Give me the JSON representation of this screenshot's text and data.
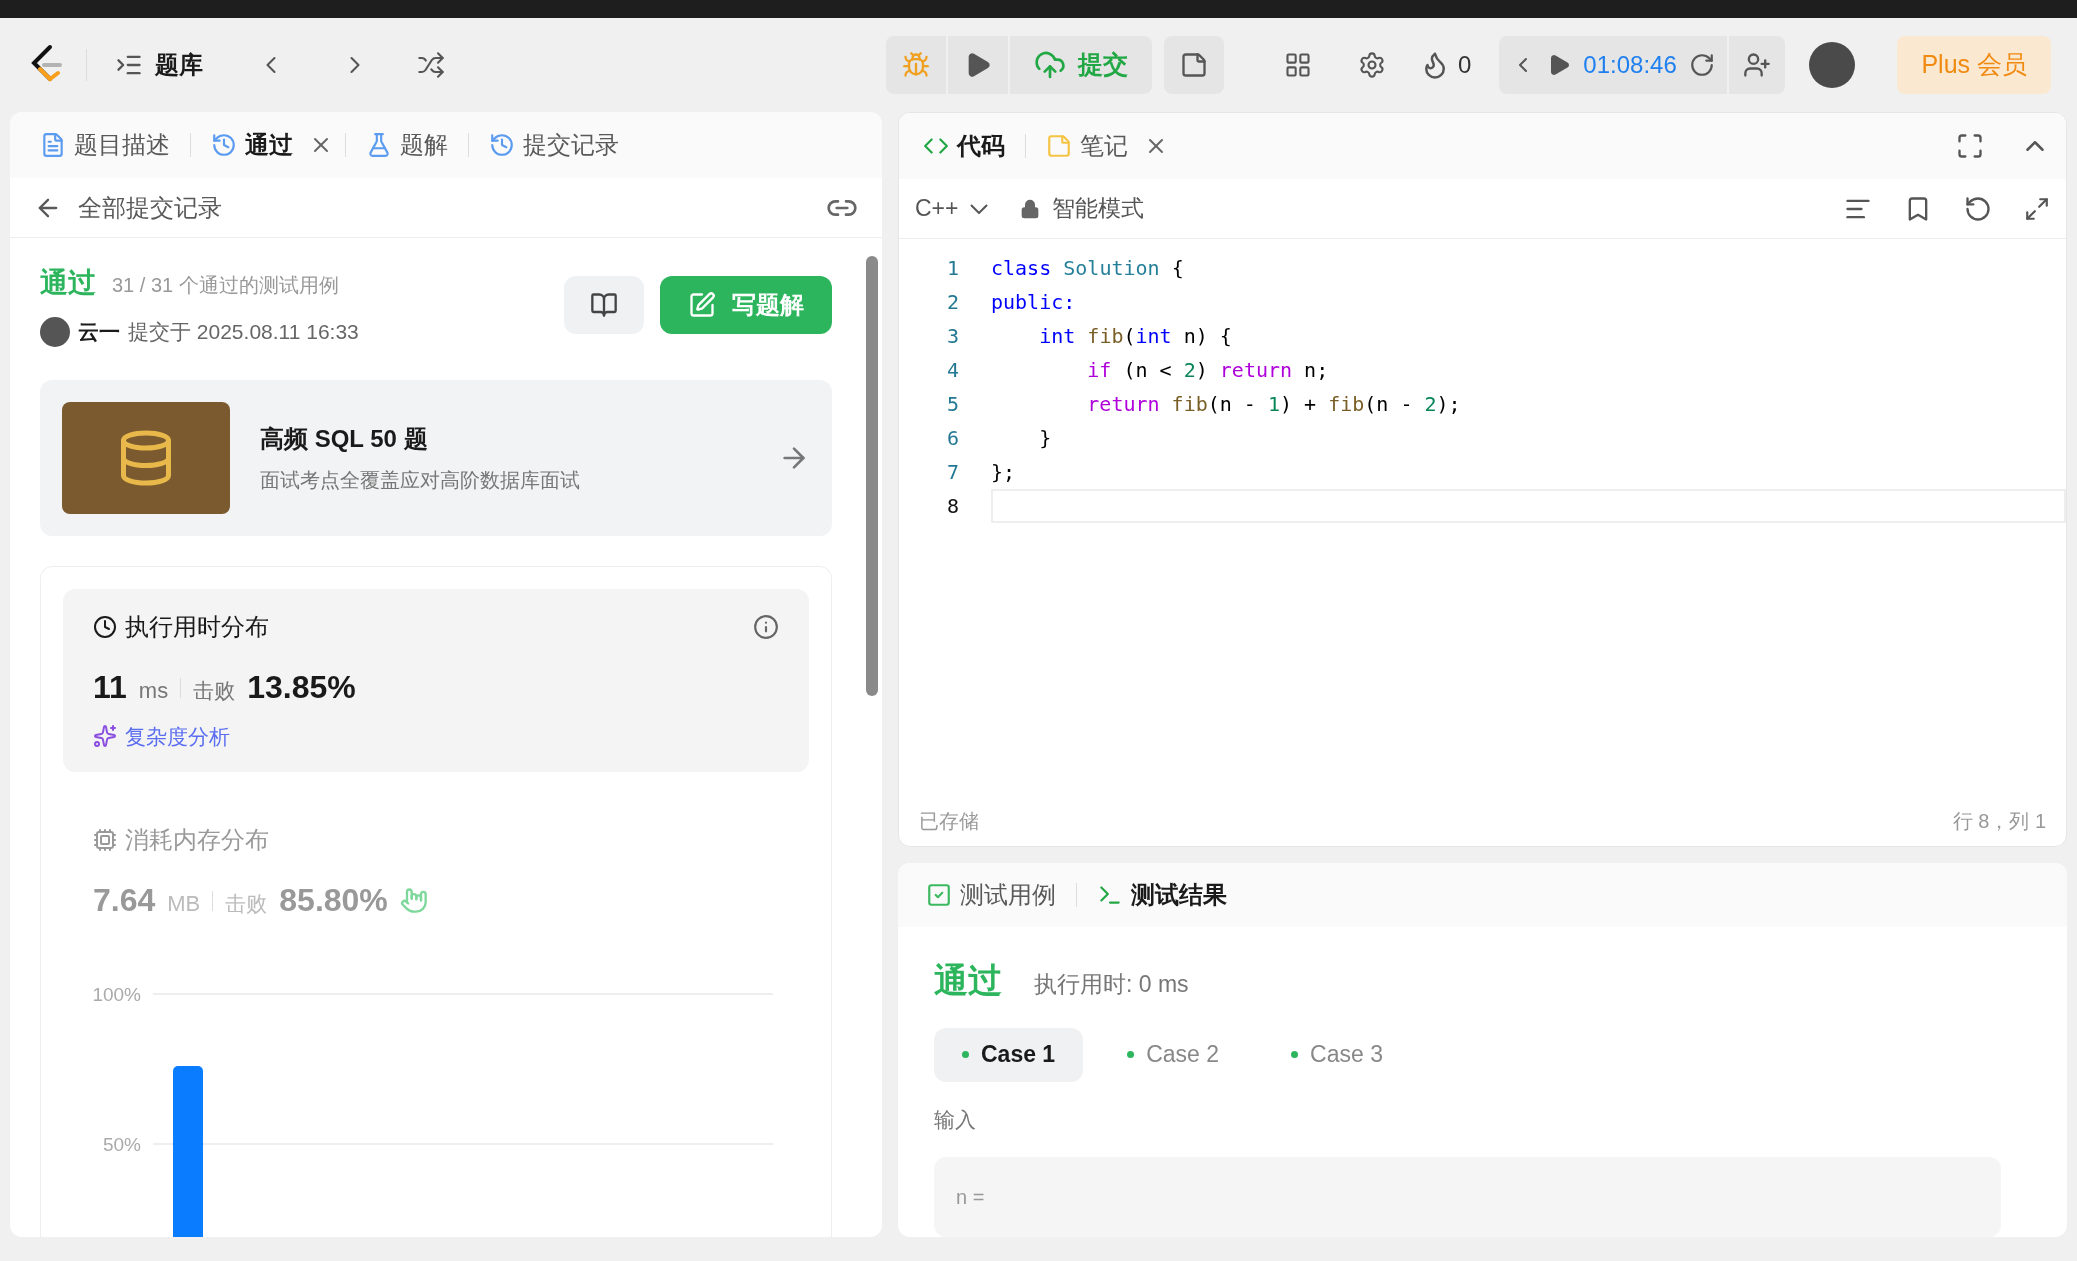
{
  "nav": {
    "problem_list": "题库",
    "submit": "提交",
    "streak": "0",
    "timer": "01:08:46",
    "plus": "Plus 会员"
  },
  "left_tabs": [
    {
      "kind": "doc",
      "label": "题目描述",
      "selected": false,
      "closable": false
    },
    {
      "kind": "history",
      "label": "通过",
      "selected": true,
      "closable": true
    },
    {
      "kind": "flask",
      "label": "题解",
      "selected": false,
      "closable": false
    },
    {
      "kind": "history",
      "label": "提交记录",
      "selected": false,
      "closable": false
    }
  ],
  "back": {
    "label": "全部提交记录"
  },
  "submission": {
    "status": "通过",
    "cases": "31 / 31 个通过的测试用例",
    "user": "云一",
    "submitted": "提交于 2025.08.11 16:33",
    "write_button": "写题解"
  },
  "promo": {
    "title": "高频 SQL 50 题",
    "subtitle": "面试考点全覆盖应对高阶数据库面试"
  },
  "metrics": [
    {
      "kind": "time",
      "title": "执行用时分布",
      "value": "11",
      "unit": "ms",
      "beat_label": "击败",
      "beat": "13.85%",
      "selected": true,
      "analysis": "复杂度分析"
    },
    {
      "kind": "memory",
      "title": "消耗内存分布",
      "value": "7.64",
      "unit": "MB",
      "beat_label": "击败",
      "beat": "85.80%",
      "selected": false
    }
  ],
  "chart_data": {
    "type": "bar",
    "values": [
      76
    ],
    "yticks": [
      {
        "value": 50,
        "label": "50%"
      },
      {
        "value": 100,
        "label": "100%"
      }
    ],
    "ylim": [
      0,
      100
    ]
  },
  "editor_tabs": [
    {
      "kind": "code",
      "label": "代码",
      "selected": true,
      "closable": false
    },
    {
      "kind": "note",
      "label": "笔记",
      "selected": false,
      "closable": true
    }
  ],
  "editor": {
    "language": "C++",
    "mode": "智能模式",
    "saved": "已存储",
    "cursor": "行 8，列 1",
    "lines": [
      {
        "number": "1",
        "current": false,
        "tokens": [
          {
            "text": "class",
            "kind": "keyword"
          },
          {
            "text": " Solution",
            "kind": "type"
          },
          {
            "text": " {",
            "kind": "plain"
          }
        ]
      },
      {
        "number": "2",
        "current": false,
        "tokens": [
          {
            "text": "public:",
            "kind": "keyword"
          }
        ]
      },
      {
        "number": "3",
        "current": false,
        "tokens": [
          {
            "text": "    int",
            "kind": "keyword"
          },
          {
            "text": " fib",
            "kind": "func"
          },
          {
            "text": "(",
            "kind": "plain"
          },
          {
            "text": "int",
            "kind": "keyword"
          },
          {
            "text": " n) {",
            "kind": "plain"
          }
        ]
      },
      {
        "number": "4",
        "current": false,
        "tokens": [
          {
            "text": "        if",
            "kind": "control"
          },
          {
            "text": " (n < ",
            "kind": "plain"
          },
          {
            "text": "2",
            "kind": "number"
          },
          {
            "text": ") ",
            "kind": "plain"
          },
          {
            "text": "return",
            "kind": "control"
          },
          {
            "text": " n;",
            "kind": "plain"
          }
        ]
      },
      {
        "number": "5",
        "current": false,
        "tokens": [
          {
            "text": "        return",
            "kind": "control"
          },
          {
            "text": " fib",
            "kind": "func"
          },
          {
            "text": "(n - ",
            "kind": "plain"
          },
          {
            "text": "1",
            "kind": "number"
          },
          {
            "text": ") + ",
            "kind": "plain"
          },
          {
            "text": "fib",
            "kind": "func"
          },
          {
            "text": "(n - ",
            "kind": "plain"
          },
          {
            "text": "2",
            "kind": "number"
          },
          {
            "text": ");",
            "kind": "plain"
          }
        ]
      },
      {
        "number": "6",
        "current": false,
        "tokens": [
          {
            "text": "    }",
            "kind": "plain"
          }
        ]
      },
      {
        "number": "7",
        "current": false,
        "tokens": [
          {
            "text": "};",
            "kind": "plain"
          }
        ]
      },
      {
        "number": "8",
        "current": true
      }
    ]
  },
  "result_tabs": [
    {
      "kind": "testcase",
      "label": "测试用例",
      "selected": false
    },
    {
      "kind": "terminal",
      "label": "测试结果",
      "selected": true
    }
  ],
  "result": {
    "status": "通过",
    "runtime": "执行用时: 0 ms",
    "input_label": "输入",
    "input_prefix": "n =",
    "cases": [
      {
        "label": "Case 1",
        "selected": true
      },
      {
        "label": "Case 2",
        "selected": false
      },
      {
        "label": "Case 3",
        "selected": false
      }
    ]
  }
}
